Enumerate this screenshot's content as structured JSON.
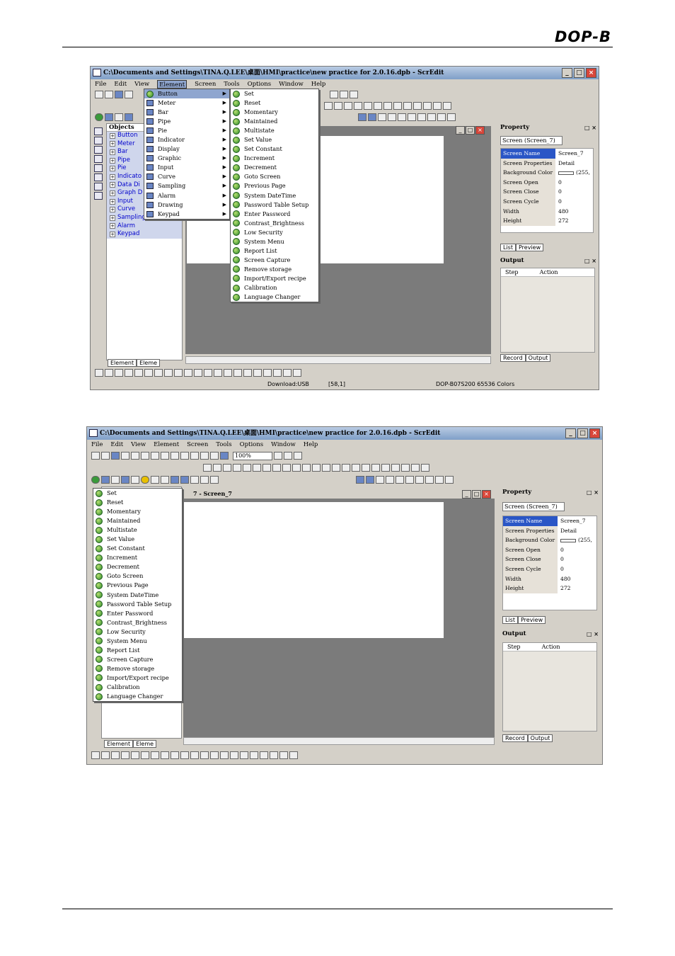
{
  "page_header": {
    "logo": "DOP-B"
  },
  "shot1": {
    "title": "C:\\Documents and Settings\\TINA.Q.LEE\\桌面\\HMI\\practice\\new practice for 2.0.16.dpb - ScrEdit",
    "menus": [
      "File",
      "Edit",
      "View",
      "Element",
      "Screen",
      "Tools",
      "Options",
      "Window",
      "Help"
    ],
    "open_menu": "Element",
    "element_menu": [
      "Button",
      "Meter",
      "Bar",
      "Pipe",
      "Pie",
      "Indicator",
      "Display",
      "Graphic",
      "Input",
      "Curve",
      "Sampling",
      "Alarm",
      "Drawing",
      "Keypad"
    ],
    "button_submenu": [
      "Set",
      "Reset",
      "Momentary",
      "Maintained",
      "Multistate",
      "Set Value",
      "Set Constant",
      "Increment",
      "Decrement",
      "Goto Screen",
      "Previous Page",
      "System DateTime",
      "Password Table Setup",
      "Enter Password",
      "Contrast_Brightness",
      "Low Security",
      "System Menu",
      "Report List",
      "Screen Capture",
      "Remove storage",
      "Import/Export recipe",
      "Calibration",
      "Language Changer"
    ],
    "objects_header": "Objects",
    "objects": [
      "Button",
      "Meter",
      "Bar",
      "Pipe",
      "Pie",
      "Indicato",
      "Data Di",
      "Graph D",
      "Input",
      "Curve",
      "Sampling",
      "Alarm",
      "Keypad"
    ],
    "tabs": [
      "Element",
      "Eleme"
    ],
    "property": {
      "title": "Property",
      "selector": "Screen (Screen_7)",
      "rows": [
        {
          "k": "Screen Name",
          "v": "Screen_7"
        },
        {
          "k": "Screen Properties",
          "v": "Detail"
        },
        {
          "k": "Background Color",
          "v": "(255,"
        },
        {
          "k": "Screen Open Macro",
          "v": "0"
        },
        {
          "k": "Screen Close Macro",
          "v": "0"
        },
        {
          "k": "Screen Cycle Macro",
          "v": "0"
        },
        {
          "k": "Width",
          "v": "480"
        },
        {
          "k": "Height",
          "v": "272"
        }
      ],
      "tabs": [
        "List",
        "Preview"
      ]
    },
    "output": {
      "title": "Output",
      "cols": [
        "Step",
        "Action"
      ],
      "tabs": [
        "Record",
        "Output"
      ]
    },
    "status": {
      "left": "Download:USB",
      "mid": "[58,1]",
      "right": "DOP-B07S200 65536 Colors"
    }
  },
  "shot2": {
    "title": "C:\\Documents and Settings\\TINA.Q.LEE\\桌面\\HMI\\practice\\new practice for 2.0.16.dpb - ScrEdit",
    "menus": [
      "File",
      "Edit",
      "View",
      "Element",
      "Screen",
      "Tools",
      "Options",
      "Window",
      "Help"
    ],
    "zoom": "100%",
    "child_title": "7 - Screen_7",
    "button_list": [
      "Set",
      "Reset",
      "Momentary",
      "Maintained",
      "Multistate",
      "Set Value",
      "Set Constant",
      "Increment",
      "Decrement",
      "Goto Screen",
      "Previous Page",
      "System DateTime",
      "Password Table Setup",
      "Enter Password",
      "Contrast_Brightness",
      "Low Security",
      "System Menu",
      "Report List",
      "Screen Capture",
      "Remove storage",
      "Import/Export recipe",
      "Calibration",
      "Language Changer"
    ],
    "tabs": [
      "Element",
      "Eleme"
    ],
    "property": {
      "title": "Property",
      "selector": "Screen (Screen_7)",
      "rows": [
        {
          "k": "Screen Name",
          "v": "Screen_7"
        },
        {
          "k": "Screen Properties",
          "v": "Detail"
        },
        {
          "k": "Background Color",
          "v": "(255,"
        },
        {
          "k": "Screen Open Macro",
          "v": "0"
        },
        {
          "k": "Screen Close Macro",
          "v": "0"
        },
        {
          "k": "Screen Cycle Macro",
          "v": "0"
        },
        {
          "k": "Width",
          "v": "480"
        },
        {
          "k": "Height",
          "v": "272"
        }
      ],
      "tabs": [
        "List",
        "Preview"
      ]
    },
    "output": {
      "title": "Output",
      "cols": [
        "Step",
        "Action"
      ],
      "tabs": [
        "Record",
        "Output"
      ]
    }
  }
}
